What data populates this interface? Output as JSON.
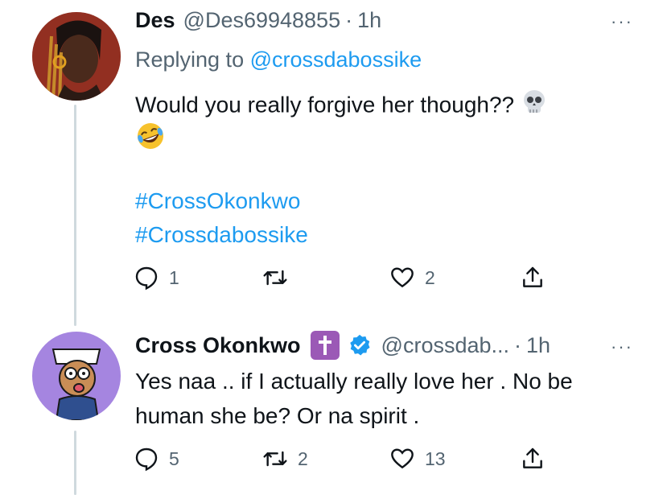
{
  "tweet1": {
    "name": "Des",
    "handle": "@Des69948855",
    "dot": "·",
    "time": "1h",
    "more": "···",
    "replying_prefix": "Replying to ",
    "replying_handle": "@crossdabossike",
    "text_line1": "Would you really forgive her though??",
    "hashtag1": "#CrossOkonkwo",
    "hashtag2": "#Crossdabossike",
    "reply_count": "1",
    "retweet_count": "",
    "like_count": "2",
    "emojis": [
      "skull-emoji",
      "rolling-laughing-emoji"
    ]
  },
  "tweet2": {
    "name": "Cross Okonkwo",
    "handle": "@crossdab...",
    "dot": "·",
    "time": "1h",
    "more": "···",
    "text_line1": "Yes naa .. if I actually really love her . No be",
    "text_line2": "human she be? Or na spirit .",
    "reply_count": "5",
    "retweet_count": "2",
    "like_count": "13"
  },
  "colors": {
    "link": "#1d9bf0",
    "muted": "#536471",
    "badge": "#9b59b6",
    "thread_line": "#cfd9de"
  }
}
